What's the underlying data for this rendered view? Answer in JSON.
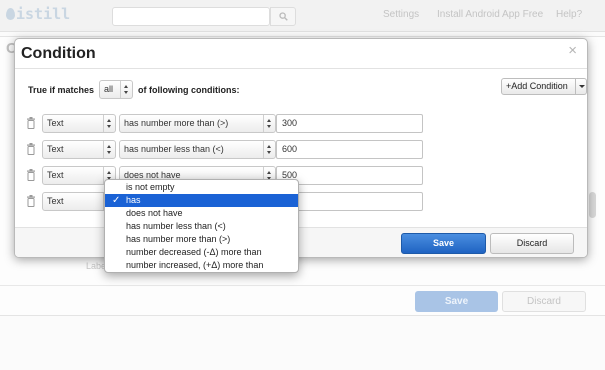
{
  "topbar": {
    "logo": "istill",
    "nav": [
      "Settings",
      "Install Android App Free",
      "Help?"
    ]
  },
  "background": {
    "section_initial": "C",
    "faint_label": "Labe",
    "save_label": "Save",
    "discard_label": "Discard"
  },
  "modal": {
    "title": "Condition",
    "close_glyph": "×",
    "match_label": "True if matches",
    "match_value": "all",
    "match_suffix": "of following conditions:",
    "add_condition_label": "+Add Condition",
    "save_label": "Save",
    "discard_label": "Discard"
  },
  "conditions": [
    {
      "field": "Text",
      "operator": "has number more than (>)",
      "value": "300"
    },
    {
      "field": "Text",
      "operator": "has number less than (<)",
      "value": "600"
    },
    {
      "field": "Text",
      "operator": "does not have",
      "value": "500"
    },
    {
      "field": "Text",
      "operator": "",
      "value": ""
    }
  ],
  "dropdown": {
    "selected_index": 1,
    "check_glyph": "✓",
    "options": [
      "is not empty",
      "has",
      "does not have",
      "has number less than (<)",
      "has number more than (>)",
      "number decreased (-Δ) more than",
      "number increased, (+Δ) more than"
    ]
  },
  "colors": {
    "primary_button": "#1f63c2",
    "selected_option": "#1a62d5",
    "faded_save": "#a9c4e6"
  }
}
